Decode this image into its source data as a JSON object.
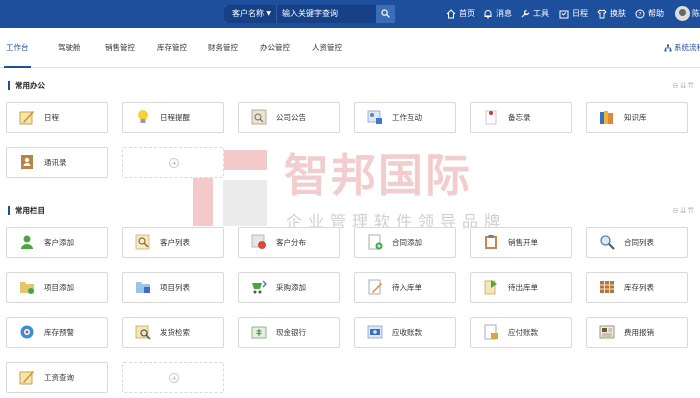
{
  "search": {
    "type_label": "客户名称",
    "placeholder": "输入关键字查询"
  },
  "topnav": {
    "home": "首页",
    "messages": "消息",
    "tools": "工具",
    "schedule": "日程",
    "skin": "换肤",
    "help": "帮助",
    "user": "陈"
  },
  "tabs": [
    "工作台",
    "驾驶舱",
    "销售管控",
    "库存管控",
    "财务管控",
    "办公管控",
    "人资管控"
  ],
  "system_flow": "系统流程",
  "office": {
    "title": "常用办公",
    "tools": "⊖⇊⇈",
    "items": [
      "日程",
      "日程提醒",
      "公司公告",
      "工作互动",
      "备忘录",
      "知识库",
      "通讯录"
    ]
  },
  "columns": {
    "title": "常用栏目",
    "tools": "⊖⇊⇈",
    "items": [
      "客户添加",
      "客户列表",
      "客户分布",
      "合同添加",
      "销售开单",
      "合同列表",
      "项目添加",
      "项目列表",
      "采购添加",
      "待入库单",
      "待出库单",
      "库存列表",
      "库存预警",
      "发货检索",
      "现金银行",
      "应收账款",
      "应付账款",
      "费用报销",
      "工资查询"
    ]
  },
  "watermark": {
    "title": "智邦国际",
    "subtitle": "企业管理软件领导品牌"
  }
}
